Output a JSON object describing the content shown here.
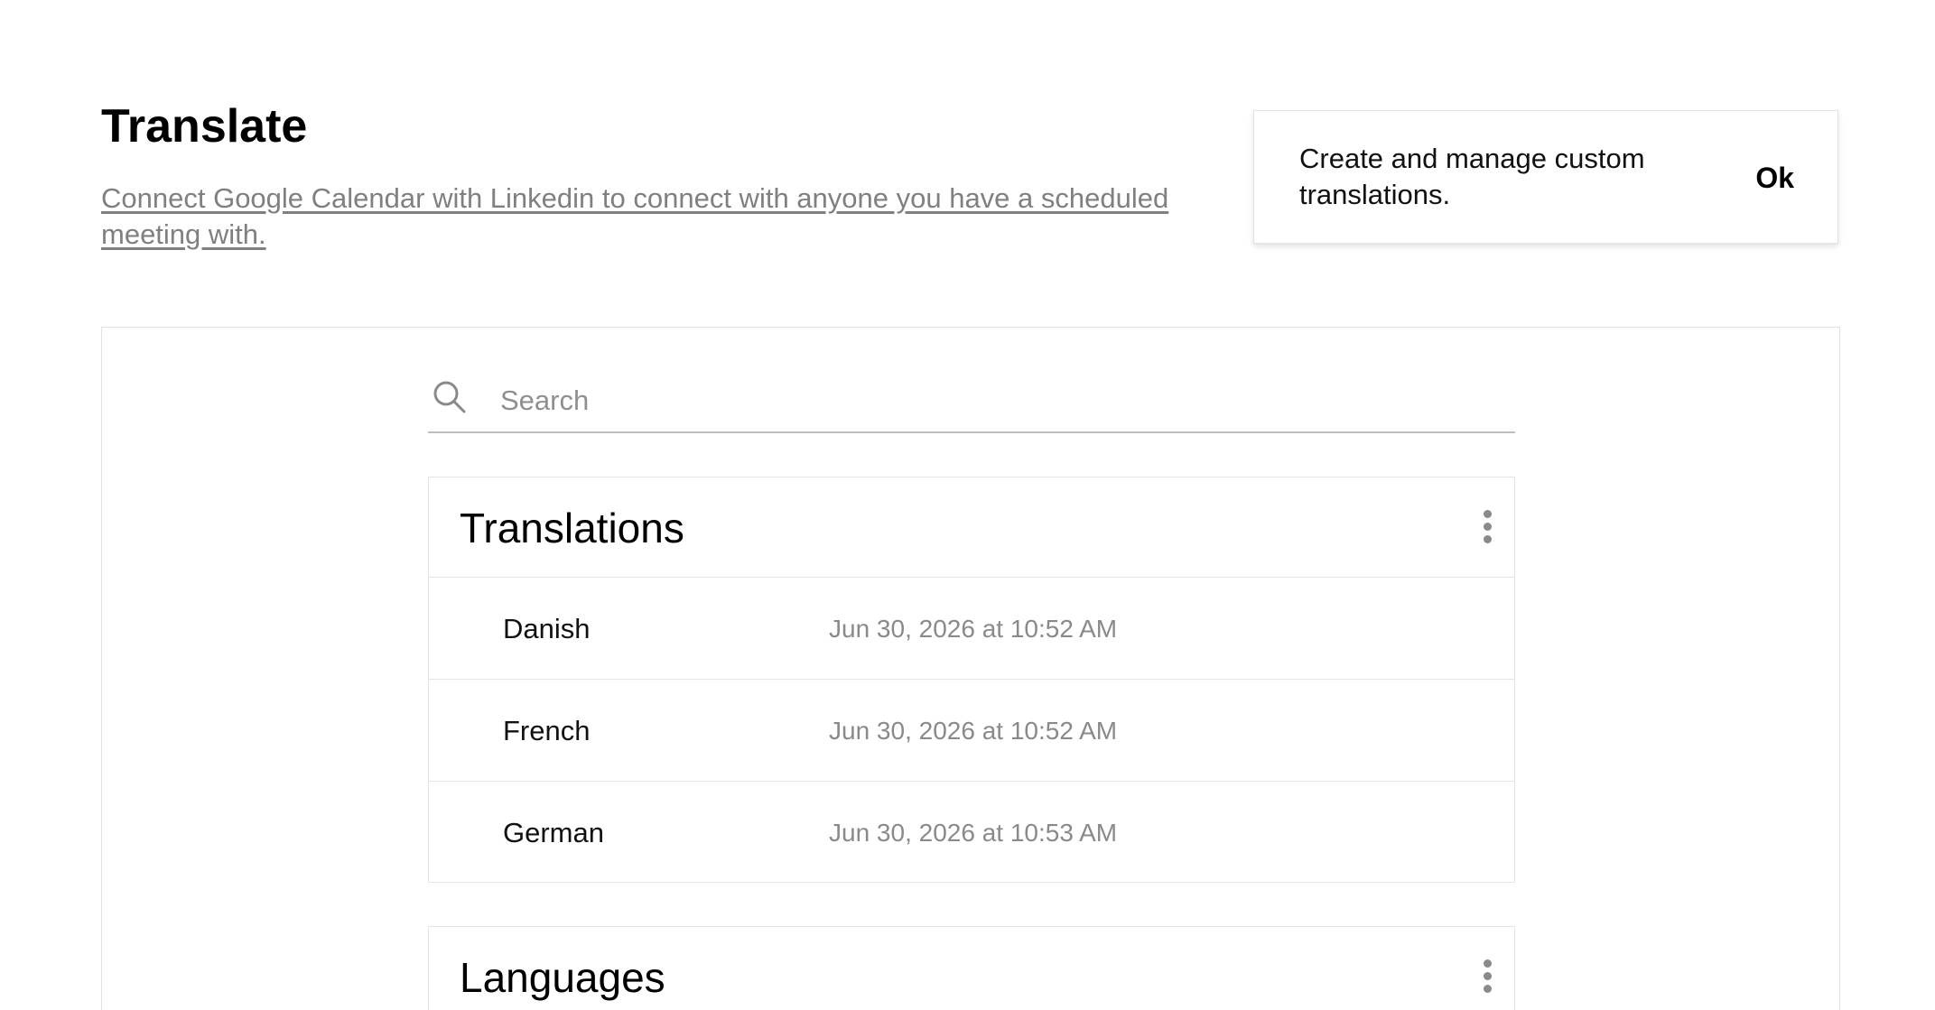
{
  "header": {
    "title": "Translate",
    "description_link": "Connect Google Calendar with Linkedin to connect with anyone you have a scheduled meeting with."
  },
  "toast": {
    "message": "Create and manage custom translations.",
    "ok_label": "Ok"
  },
  "search": {
    "placeholder": "Search",
    "value": ""
  },
  "translations": {
    "title": "Translations",
    "items": [
      {
        "name": "Danish",
        "date": "Jun 30, 2026 at 10:52 AM"
      },
      {
        "name": "French",
        "date": "Jun 30, 2026 at 10:52 AM"
      },
      {
        "name": "German",
        "date": "Jun 30, 2026 at 10:53 AM"
      }
    ]
  },
  "languages": {
    "title": "Languages"
  },
  "icons": {
    "search": "search-icon",
    "more": "more-vertical-icon"
  },
  "colors": {
    "muted_text": "#808080",
    "border": "#e5e5e5",
    "icon": "#8a8a8a"
  }
}
